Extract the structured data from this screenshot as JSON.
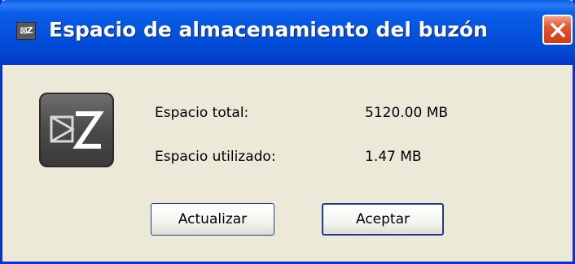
{
  "window": {
    "title": "Espacio de almacenamiento del buzón",
    "title_icon_text": "EZ",
    "close_icon": "close-icon"
  },
  "logo": {
    "icon": "zimbra-logo"
  },
  "info": {
    "total_label": "Espacio total:",
    "total_value": "5120.00 MB",
    "used_label": "Espacio utilizado:",
    "used_value": "1.47 MB"
  },
  "buttons": {
    "refresh_label": "Actualizar",
    "accept_label": "Aceptar"
  },
  "colors": {
    "titlebar": "#0351dc",
    "window_bg": "#ece9d8",
    "close": "#d33b17",
    "button_border": "#1c3f8a"
  }
}
